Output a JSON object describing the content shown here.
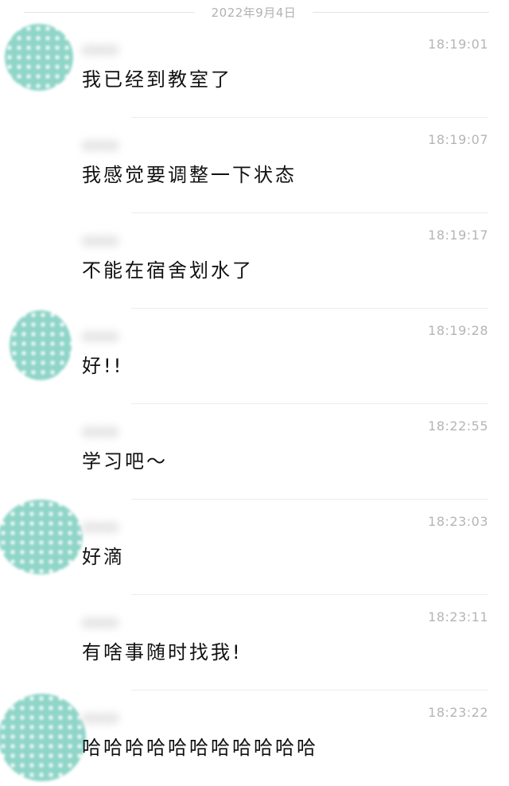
{
  "date_header": "2022年9月4日",
  "messages": [
    {
      "time": "18:19:01",
      "text": "我已经到教室了"
    },
    {
      "time": "18:19:07",
      "text": "我感觉要调整一下状态"
    },
    {
      "time": "18:19:17",
      "text": "不能在宿舍划水了"
    },
    {
      "time": "18:19:28",
      "text": "好!!"
    },
    {
      "time": "18:22:55",
      "text": "学习吧～"
    },
    {
      "time": "18:23:03",
      "text": "好滴"
    },
    {
      "time": "18:23:11",
      "text": "有啥事随时找我!"
    },
    {
      "time": "18:23:22",
      "text": "哈哈哈哈哈哈哈哈哈哈哈"
    }
  ],
  "colors": {
    "avatar_teal": "#8fd5c8",
    "timestamp_gray": "#b5b5b5",
    "divider_gray": "#ececec"
  }
}
